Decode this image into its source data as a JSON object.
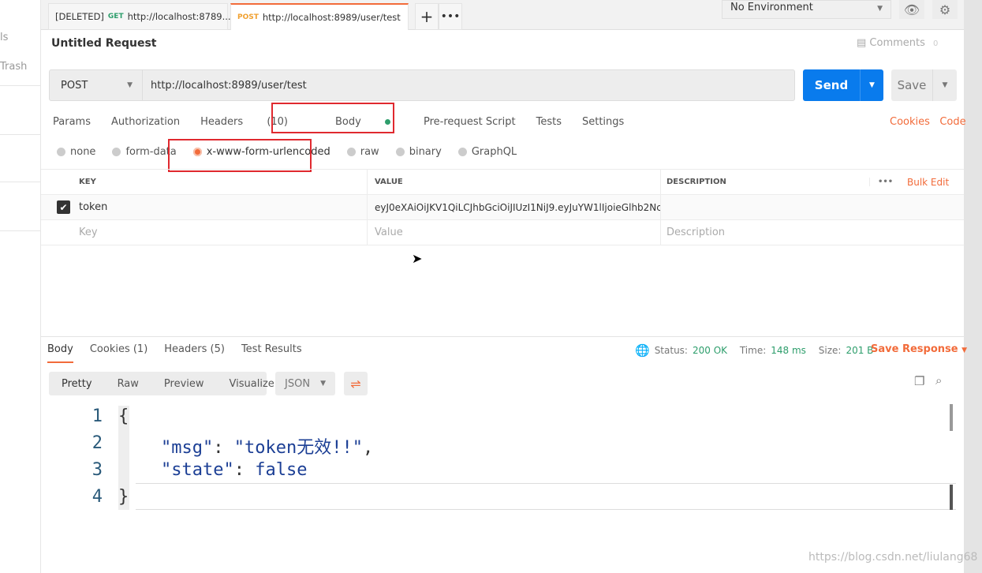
{
  "sidebar": {
    "items": [
      "ls",
      "Trash"
    ]
  },
  "tabs": [
    {
      "prefix": "[DELETED]",
      "method": "GET",
      "url": "http://localhost:8789..."
    },
    {
      "method": "POST",
      "url": "http://localhost:8989/user/test"
    }
  ],
  "environment": "No Environment",
  "request": {
    "title": "Untitled Request",
    "comments": "Comments",
    "comments_count": "0",
    "method": "POST",
    "url": "http://localhost:8989/user/test",
    "send": "Send",
    "save": "Save"
  },
  "req_tabs": [
    "Params",
    "Authorization",
    "Headers",
    "(10)",
    "Body",
    "Pre-request Script",
    "Tests",
    "Settings"
  ],
  "cookies": "Cookies",
  "code": "Code",
  "body_types": [
    "none",
    "form-data",
    "x-www-form-urlencoded",
    "raw",
    "binary",
    "GraphQL"
  ],
  "table": {
    "headers": [
      "KEY",
      "VALUE",
      "DESCRIPTION"
    ],
    "bulk_edit": "Bulk Edit",
    "rows": [
      {
        "key": "token",
        "value": "eyJ0eXAiOiJKV1QiLCJhbGciOiJIUzI1NiJ9.eyJuYW1lIjoieGlhb2Nc ...",
        "checked": true
      }
    ],
    "placeholders": {
      "key": "Key",
      "value": "Value",
      "description": "Description"
    }
  },
  "response": {
    "tabs": [
      "Body",
      "Cookies (1)",
      "Headers (5)",
      "Test Results"
    ],
    "status_label": "Status:",
    "status": "200 OK",
    "time_label": "Time:",
    "time": "148 ms",
    "size_label": "Size:",
    "size": "201 B",
    "save_response": "Save Response",
    "views": [
      "Pretty",
      "Raw",
      "Preview",
      "Visualize"
    ],
    "format": "JSON",
    "lines": [
      "1",
      "2",
      "3",
      "4"
    ],
    "code": {
      "open": "{",
      "msg_key": "\"msg\"",
      "msg_val": "\"token无效!!\"",
      "state_key": "\"state\"",
      "state_val": "false",
      "close": "}"
    }
  },
  "watermark": "https://blog.csdn.net/liulang68",
  "colors": {
    "accent": "#f26b3a",
    "send": "#097bed",
    "status_ok": "#2e9e6c",
    "highlight_box": "#e0292f"
  }
}
